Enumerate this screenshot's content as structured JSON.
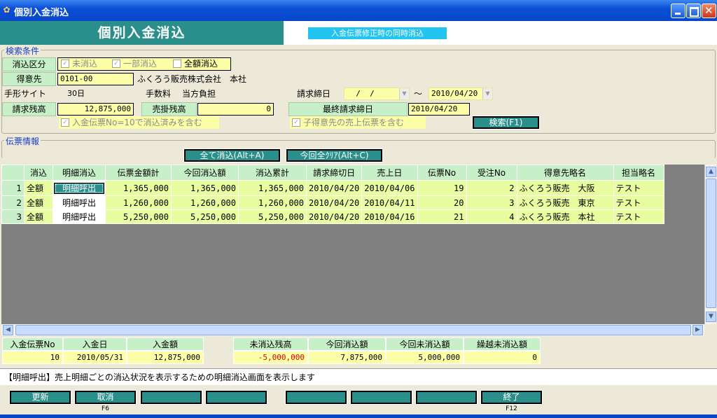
{
  "window": {
    "title": "個別入金消込"
  },
  "header": {
    "title": "個別入金消込",
    "badge": "入金伝票修正時の同時消込"
  },
  "search": {
    "group_label": "検索条件",
    "keshikomi_kubun_label": "消込区分",
    "opt_unapplied": "未消込",
    "opt_partial": "一部消込",
    "opt_full": "全額消込",
    "customer_label": "得意先",
    "customer_code": "0101-00",
    "customer_name": "ふくろう販売株式会社　本社",
    "tegata_label": "手形サイト",
    "tegata_value": "30日",
    "fee_label": "手数料",
    "fee_value": "当方負担",
    "closing_label": "請求締日",
    "closing_from": "  /  /",
    "tilde": "～",
    "closing_to": "2010/04/20",
    "billing_balance_label": "請求残高",
    "billing_balance": "12,875,000",
    "ar_balance_label": "売掛残高",
    "ar_balance": "0",
    "last_closing_label": "最終請求締日",
    "last_closing": "2010/04/20",
    "include_applied": "入金伝票No=10で消込済みを含む",
    "include_child": "子得意先の売上伝票を含む",
    "search_button": "検索(F1)"
  },
  "slips": {
    "group_label": "伝票情報",
    "apply_all_button": "全て消込(Alt+A)",
    "clear_all_button": "今回全ｸﾘｱ(Alt+C)",
    "columns": [
      "",
      "消込",
      "明細消込",
      "伝票金額計",
      "今回消込額",
      "消込累計",
      "請求締切日",
      "売上日",
      "伝票No",
      "受注No",
      "得意先略名",
      "担当略名"
    ],
    "rows": [
      {
        "no": "1",
        "apply": "全額",
        "detail": "明細呼出",
        "total": "1,365,000",
        "current": "1,365,000",
        "cumulative": "1,365,000",
        "closing": "2010/04/20",
        "sales_date": "2010/04/06",
        "slip_no": "19",
        "order_no": "2",
        "customer": "ふくろう販売　大阪",
        "staff": "テスト"
      },
      {
        "no": "2",
        "apply": "全額",
        "detail": "明細呼出",
        "total": "1,260,000",
        "current": "1,260,000",
        "cumulative": "1,260,000",
        "closing": "2010/04/20",
        "sales_date": "2010/04/11",
        "slip_no": "20",
        "order_no": "3",
        "customer": "ふくろう販売　東京",
        "staff": "テスト"
      },
      {
        "no": "3",
        "apply": "全額",
        "detail": "明細呼出",
        "total": "5,250,000",
        "current": "5,250,000",
        "cumulative": "5,250,000",
        "closing": "2010/04/20",
        "sales_date": "2010/04/16",
        "slip_no": "21",
        "order_no": "4",
        "customer": "ふくろう販売　本社",
        "staff": "テスト"
      }
    ]
  },
  "footer": {
    "payment_slip_no_label": "入金伝票No",
    "payment_slip_no": "10",
    "payment_date_label": "入金日",
    "payment_date": "2010/05/31",
    "payment_amount_label": "入金額",
    "payment_amount": "12,875,000",
    "unapplied_balance_label": "未消込残高",
    "unapplied_balance": "-5,000,000",
    "current_applied_label": "今回消込額",
    "current_applied": "7,875,000",
    "current_unapplied_label": "今回未消込額",
    "current_unapplied": "5,000,000",
    "carryover_label": "繰越未消込額",
    "carryover": "0"
  },
  "message": "【明細呼出】売上明細ごとの消込状況を表示するための明細消込画面を表示します",
  "fkeys": {
    "update": "更新",
    "cancel": "取消",
    "cancel_key": "F6",
    "end": "終了",
    "end_key": "F12"
  },
  "colors": {
    "header_teal": "#2a8e8a",
    "label_green": "#c8f0c8",
    "input_yellow": "#fcffa8",
    "negative": "#e00000"
  }
}
